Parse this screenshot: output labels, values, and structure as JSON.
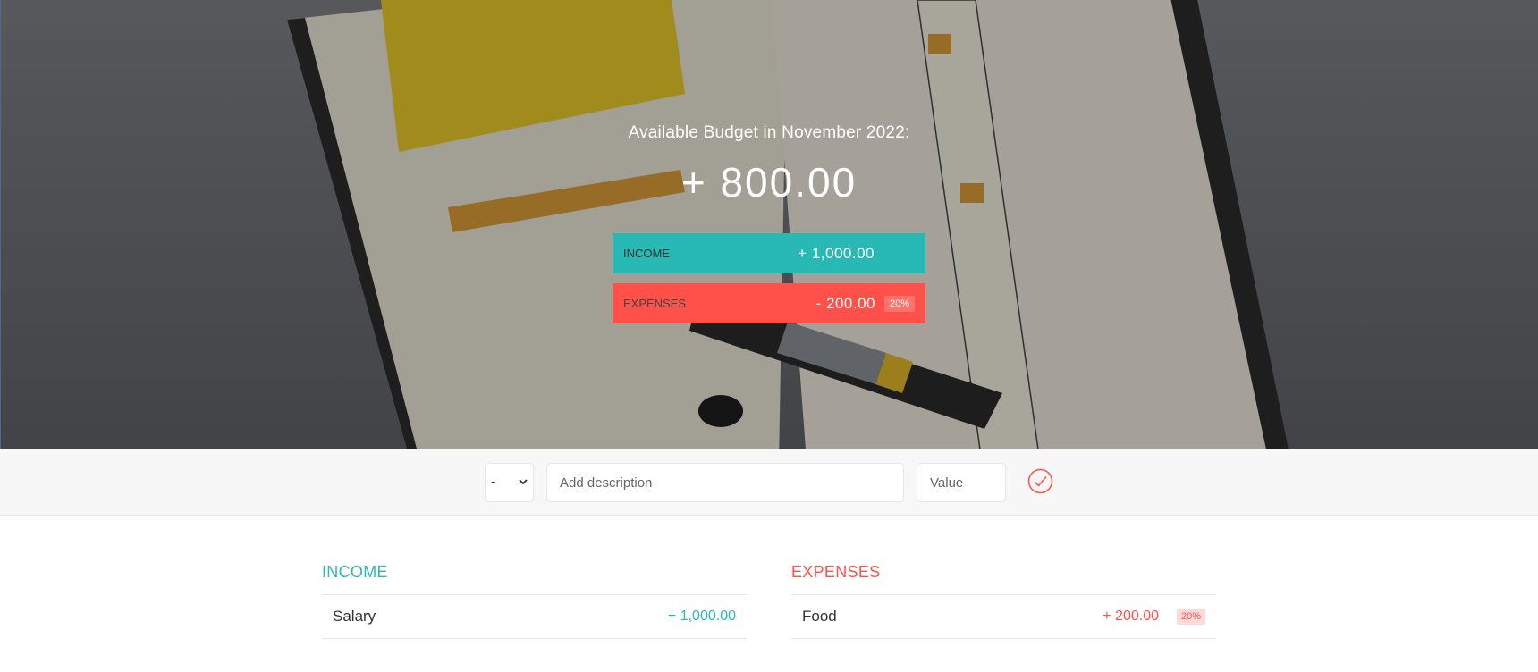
{
  "budget": {
    "title": "Available Budget in November 2022:",
    "value": "+ 800.00",
    "income_label": "Income",
    "income_value": "+ 1,000.00",
    "expenses_label": "Expenses",
    "expenses_value": "- 200.00",
    "expenses_percentage": "20%"
  },
  "add_bar": {
    "type_selected": "-",
    "description_placeholder": "Add description",
    "value_placeholder": "Value"
  },
  "income_list": {
    "title": "Income",
    "items": [
      {
        "description": "Salary",
        "value": "+ 1,000.00"
      }
    ]
  },
  "expenses_list": {
    "title": "Expenses",
    "items": [
      {
        "description": "Food",
        "value": "+ 200.00",
        "percentage": "20%"
      }
    ]
  },
  "colors": {
    "income": "#28b9b5",
    "expenses": "#ff5049",
    "add_bar_bg": "#f7f7f7"
  },
  "icons": {
    "add_button": "checkmark-circle-icon",
    "select_caret": "chevron-down-icon"
  }
}
